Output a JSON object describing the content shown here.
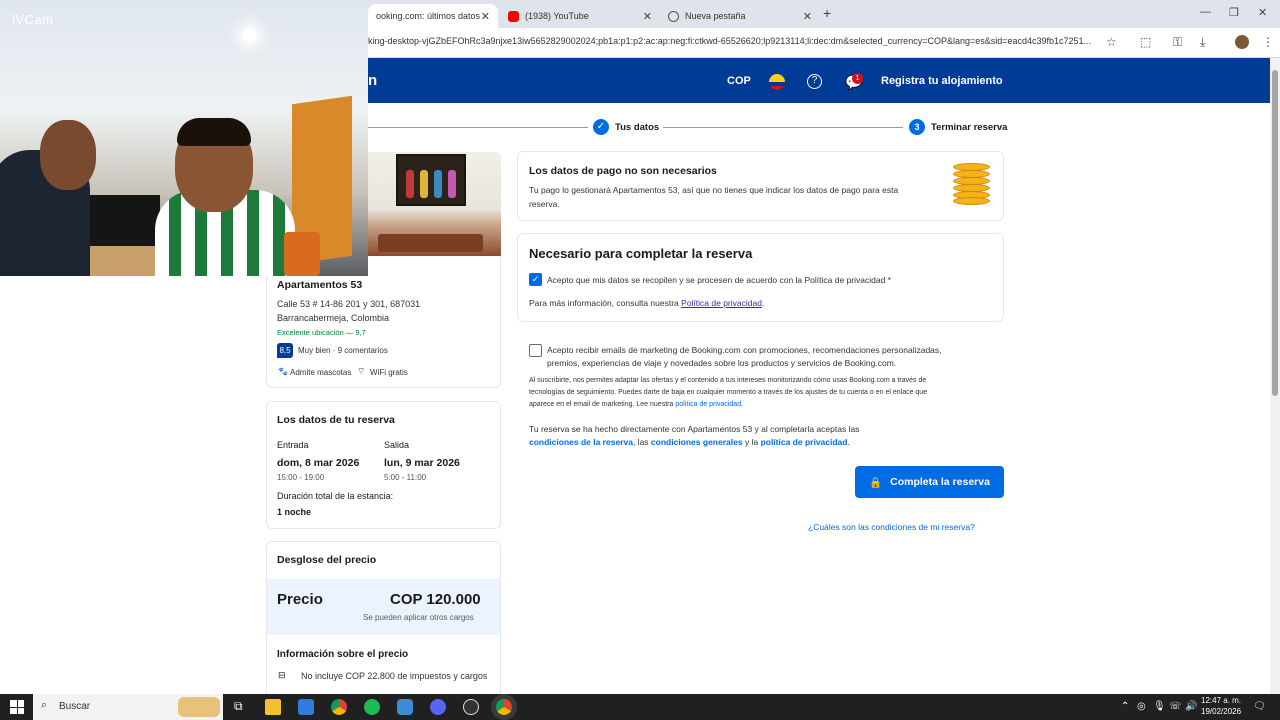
{
  "browser": {
    "tabs": [
      {
        "label": "ooking.com: últimos datos",
        "active": true
      },
      {
        "label": "(1938) YouTube",
        "active": false
      },
      {
        "label": "Nueva pestaña",
        "active": false
      }
    ],
    "url": "king-desktop-vjGZbEFOhRc3a9njxe13iw5652829002024;pb1a:p1:p2:ac:ap:neg:fi:ctkwd-65526620;lp9213114;li:dec:dm&selected_currency=COP&lang=es&sid=eacd4c39fb1c7251..."
  },
  "webcam": {
    "label": "iVCam"
  },
  "header": {
    "logo_fragment": "n",
    "currency": "COP",
    "help_glyph": "?",
    "notification_count": "1",
    "register_label": "Registra tu alojamiento"
  },
  "progress": {
    "step2_label": "Tus datos",
    "step3_number": "3",
    "step3_label": "Terminar reserva"
  },
  "property": {
    "name": "Apartamentos 53",
    "address_line1": "Calle 53 # 14-86 201 y 301, 687031",
    "address_line2": "Barrancabermeja, Colombia",
    "location_score": "Excelente ubicación — 9,7",
    "rating": "8,5",
    "rating_text": "Muy bien · 9 comentarios",
    "amenity1": "Admite mascotas",
    "amenity2": "WiFi gratis"
  },
  "booking_details": {
    "title": "Los datos de tu reserva",
    "checkin_label": "Entrada",
    "checkin_date": "dom, 8 mar 2026",
    "checkin_time": "15:00 - 19:00",
    "checkout_label": "Salida",
    "checkout_date": "lun, 9 mar 2026",
    "checkout_time": "5:00 - 11:00",
    "duration_label": "Duración total de la estancia:",
    "duration_value": "1 noche"
  },
  "price": {
    "title": "Desglose del precio",
    "label": "Precio",
    "amount": "COP 120.000",
    "note": "Se pueden aplicar otros cargos",
    "info_title": "Información sobre el precio",
    "info_line": "No incluye COP 22.800 de impuestos y cargos"
  },
  "payment_notice": {
    "title": "Los datos de pago no son necesarios",
    "line1": "Tu pago lo gestionará Apartamentos 53, así que no tienes que indicar los datos de pago para esta",
    "line2": "reserva."
  },
  "required": {
    "title": "Necesario para completar la reserva",
    "privacy_consent": "Acepto que mis datos se recopilen y se procesen de acuerdo con la Política de privacidad *",
    "more_info_prefix": "Para más información, consulta nuestra",
    "privacy_link": "Política de privacidad",
    "more_info_suffix": "."
  },
  "marketing": {
    "line1": "Acepto recibir emails de marketing de Booking.com con promociones, recomendaciones personalizadas,",
    "line2": "premios, experiencias de viaje y novedades sobre los productos y servicios de Booking.com.",
    "fine1": "Al suscribirte, nos permites adaptar las ofertas y el contenido a tus intereses monitorizando cómo usas Booking.com a través de",
    "fine2": "tecnologías de seguimiento. Puedes darte de baja en cualquier momento a través de los ajustes de tu cuenta o en el enlace que",
    "fine3_prefix": "aparece en el email de marketing. Lee nuestra",
    "fine3_link": "política de privacidad",
    "fine3_suffix": "."
  },
  "terms": {
    "line1": "Tu reserva se ha hecho directamente con Apartamentos 53 y al completarla aceptas las",
    "link1": "condiciones de la reserva",
    "sep1": ", las",
    "link2": "condiciones generales",
    "sep2": "y la",
    "link3": "política de privacidad",
    "end": "."
  },
  "actions": {
    "complete_label": "Completa la reserva",
    "conditions_link": "¿Cuáles son las condiciones de mi reserva?"
  },
  "taskbar": {
    "search_placeholder": "Buscar",
    "time": "12:47 a. m.",
    "date": "19/02/2026"
  },
  "colors": {
    "brand": "#003b95",
    "accent": "#006ce4"
  }
}
